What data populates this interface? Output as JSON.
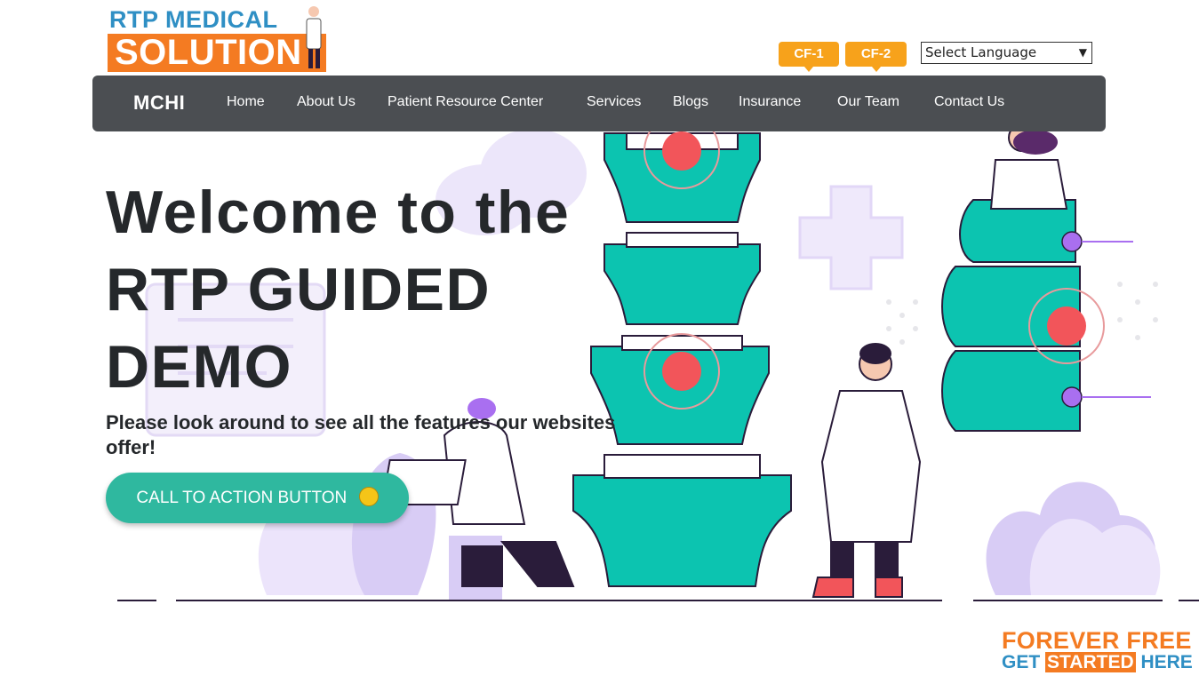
{
  "logo": {
    "line1": "RTP MEDICAL",
    "line2": "SOLUTION"
  },
  "badges": {
    "cf1": "CF-1",
    "cf2": "CF-2"
  },
  "language": {
    "selected": "Select Language"
  },
  "nav": {
    "brand": "MCHI",
    "items": [
      "Home",
      "About Us",
      "Patient Resource Center",
      "Services",
      "Blogs",
      "Insurance",
      "Our Team",
      "Contact Us"
    ]
  },
  "hero": {
    "title_line1": "Welcome to the",
    "title_line2": "RTP GUIDED",
    "title_line3": "DEMO",
    "subtitle": "Please look around to see all the features our websites offer!",
    "cta_label": "CALL TO ACTION BUTTON",
    "cta_icon": "grinning-face-emoji-icon"
  },
  "footer_badge": {
    "line1": "FOREVER FREE",
    "line2_a": "GET ",
    "line2_b": "STARTED",
    "line2_c": " HERE"
  },
  "colors": {
    "nav_bg": "#4b4e52",
    "accent_orange": "#f47b22",
    "accent_blue": "#2f8fc4",
    "teal": "#0cc4b0",
    "cta": "#2fb89f",
    "badge": "#f7a21b"
  }
}
